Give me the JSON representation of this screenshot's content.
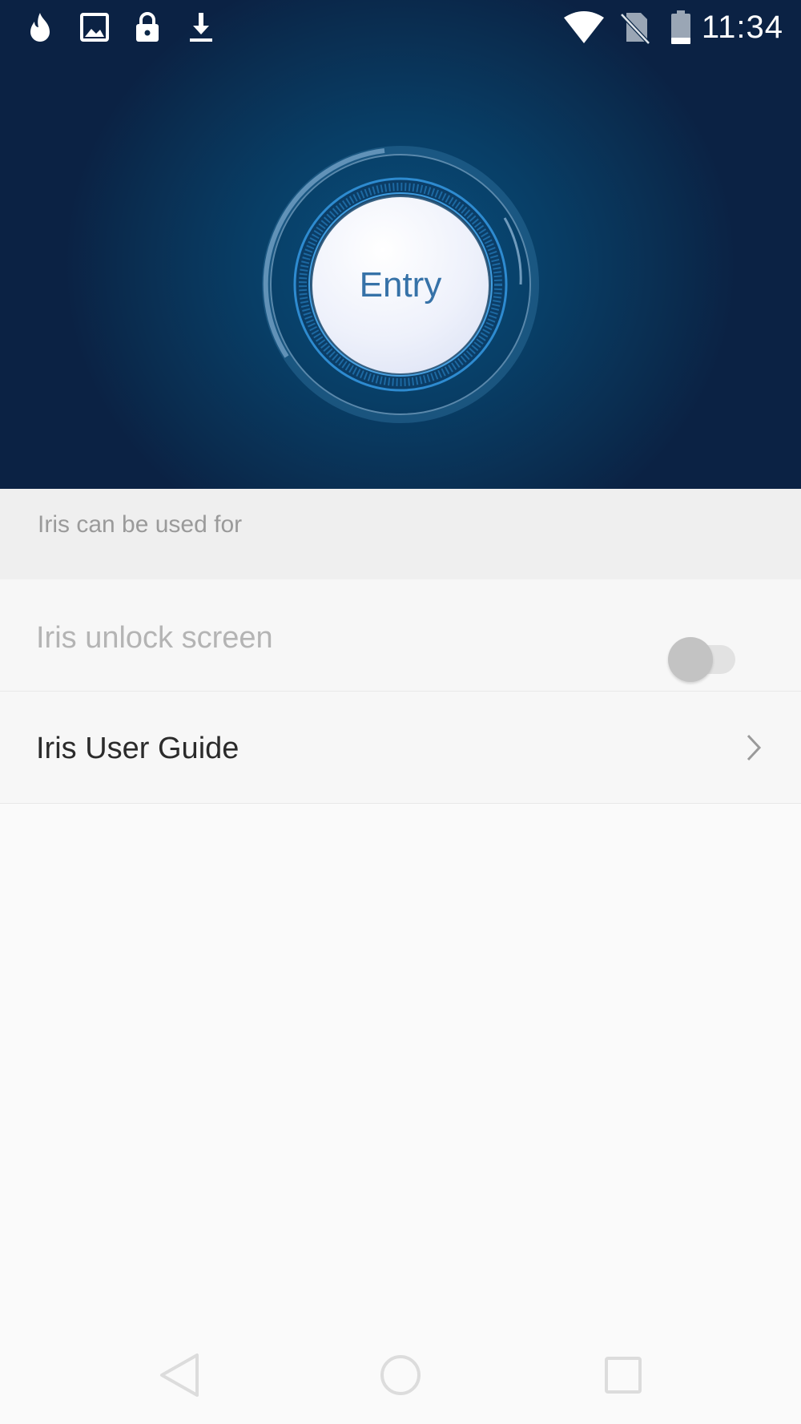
{
  "status_bar": {
    "time": "11:34",
    "left_icons": [
      "fire-icon",
      "image-icon",
      "lock-icon",
      "download-icon"
    ],
    "right_icons": [
      "wifi-icon",
      "no-sim-icon",
      "battery-icon"
    ]
  },
  "hero": {
    "entry_button_label": "Entry",
    "background_color": "#0a3a63",
    "accent_color": "#3672a8"
  },
  "section": {
    "header": "Iris can be used for"
  },
  "settings": {
    "unlock_label": "Iris unlock screen",
    "unlock_enabled": false,
    "guide_label": "Iris User Guide"
  },
  "navigation": {
    "icons": [
      "back-icon",
      "home-icon",
      "recents-icon"
    ]
  }
}
